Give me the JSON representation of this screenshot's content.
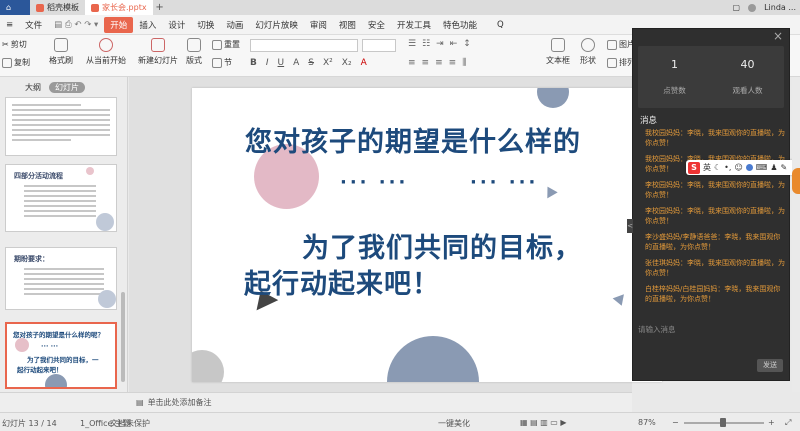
{
  "titlebar": {
    "tabs": [
      {
        "label": "",
        "active": false
      },
      {
        "label": "稻壳模板",
        "active": false
      },
      {
        "label": "家长会.pptx",
        "active": true
      }
    ],
    "user": "Linda ..."
  },
  "menubar": {
    "file": "文件",
    "items": [
      "开始",
      "插入",
      "设计",
      "切换",
      "动画",
      "幻灯片放映",
      "审阅",
      "视图",
      "安全",
      "开发工具",
      "特色功能"
    ],
    "search": "Q"
  },
  "ribbon": {
    "cut": "剪切",
    "copy": "复制",
    "format_painter": "格式刷",
    "paste": "粘贴",
    "play_from_current": "从当前开始",
    "new_slide": "新建幻灯片",
    "layout": "版式",
    "section": "节",
    "reset": "重置",
    "textbox": "文本框",
    "shape": "形状",
    "picture": "图片",
    "arrange": "排列",
    "format_buttons": [
      "B",
      "I",
      "U",
      "A",
      "S",
      "X²",
      "X₂",
      "A"
    ]
  },
  "leftpanel": {
    "tab_outline": "大纲",
    "tab_slides": "幻灯片",
    "slide2_title": "四部分活动流程",
    "slide3_title": "期盼要求：",
    "slide4_title": "您对孩子的期望是什么样的呢？",
    "slide4_dots": "··· ···",
    "slide4_line2": "为了我们共同的目标，一",
    "slide4_line3": "起行动起来吧！",
    "num_12": "12",
    "num_13": "13",
    "add": "+"
  },
  "slide": {
    "line1": "您对孩子的期望是什么样的",
    "dots_a": "··· ···",
    "dots_b": "··· ···",
    "line2": "为了我们共同的目标，",
    "line3": "起行动起来吧！"
  },
  "notes": {
    "placeholder": "单击此处添加备注"
  },
  "live": {
    "close": "×",
    "likes_value": "1",
    "likes_label": "点赞数",
    "viewers_value": "40",
    "viewers_label": "观看人数",
    "msg_title": "消息",
    "messages": [
      "我校园妈妈：李晓，我来围观你的直播啦，为你点赞！",
      "我校园妈妈：李晓，我来围观你的直播啦，为你点赞！",
      "李校园妈妈：李晓，我来围观你的直播啦，为你点赞！",
      "李校园妈妈：李晓，我来围观你的直播啦，为你点赞！",
      "李沙盛妈妈/李静语爸爸：李晓，我来围观你的直播啦，为你点赞！",
      "张佳琪妈妈：李晓，我来围观你的直播啦，为你点赞！",
      "白桂梓妈妈/白桂园妈妈：李晓，我来围观你的直播啦，为你点赞！"
    ],
    "input_placeholder": "请输入消息",
    "send": "发送",
    "collapse": "<"
  },
  "ime": {
    "brand": "S",
    "lang": "英"
  },
  "status": {
    "slide_count": "幻灯片 13 / 14",
    "theme": "1_Office 主题",
    "doc_protect": "文档未保护",
    "beautify": "一键美化",
    "zoom": "87%",
    "zoom_minus": "−",
    "zoom_plus": "+"
  },
  "colors": {
    "accent": "#e9664d",
    "slide_text": "#1d4a7c",
    "chat_text": "#e39a3a",
    "panel_bg": "#2f2f2f"
  }
}
